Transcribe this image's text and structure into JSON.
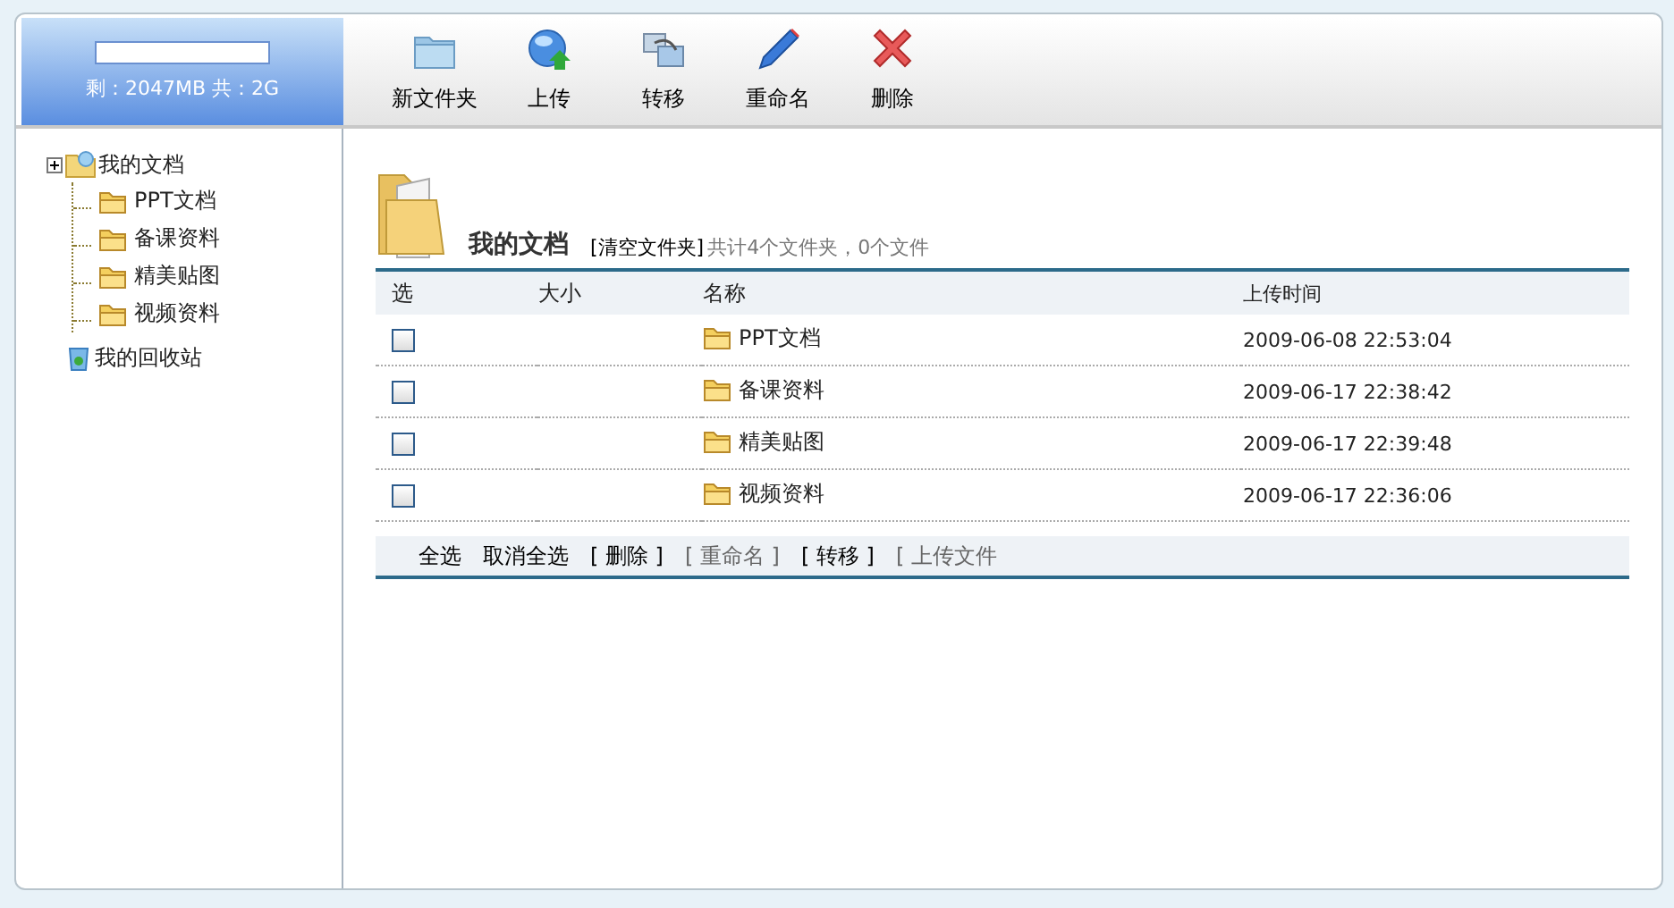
{
  "quota": {
    "text": "剩：2047MB 共：2G"
  },
  "toolbar": [
    {
      "label": "新文件夹",
      "kind": "folder"
    },
    {
      "label": "上传",
      "kind": "upload"
    },
    {
      "label": "转移",
      "kind": "move"
    },
    {
      "label": "重命名",
      "kind": "rename"
    },
    {
      "label": "删除",
      "kind": "delete"
    }
  ],
  "tree": [
    {
      "label": "我的文档",
      "kind": "docs",
      "children": [
        {
          "label": "PPT文档"
        },
        {
          "label": "备课资料"
        },
        {
          "label": "精美贴图"
        },
        {
          "label": "视频资料"
        }
      ]
    },
    {
      "label": "我的回收站",
      "kind": "recycle"
    }
  ],
  "header": {
    "title": "我的文档",
    "action": "[清空文件夹]",
    "summary": "共计4个文件夹，0个文件"
  },
  "table": {
    "columns": [
      "选",
      "大小",
      "名称",
      "上传时间"
    ],
    "rows": [
      {
        "checked": false,
        "size": "",
        "name": "PPT文档",
        "time": "2009-06-08 22:53:04"
      },
      {
        "checked": false,
        "size": "",
        "name": "备课资料",
        "time": "2009-06-17 22:38:42"
      },
      {
        "checked": false,
        "size": "",
        "name": "精美贴图",
        "time": "2009-06-17 22:39:48"
      },
      {
        "checked": false,
        "size": "",
        "name": "视频资料",
        "time": "2009-06-17 22:36:06"
      }
    ]
  },
  "actions": [
    {
      "label": "全选",
      "disabled": false
    },
    {
      "label": "取消全选",
      "disabled": false
    },
    {
      "label": "[ 删除 ]",
      "disabled": false
    },
    {
      "label": "[ 重命名 ]",
      "disabled": true
    },
    {
      "label": "[ 转移 ]",
      "disabled": false
    },
    {
      "label": "[ 上传文件",
      "disabled": true
    }
  ]
}
